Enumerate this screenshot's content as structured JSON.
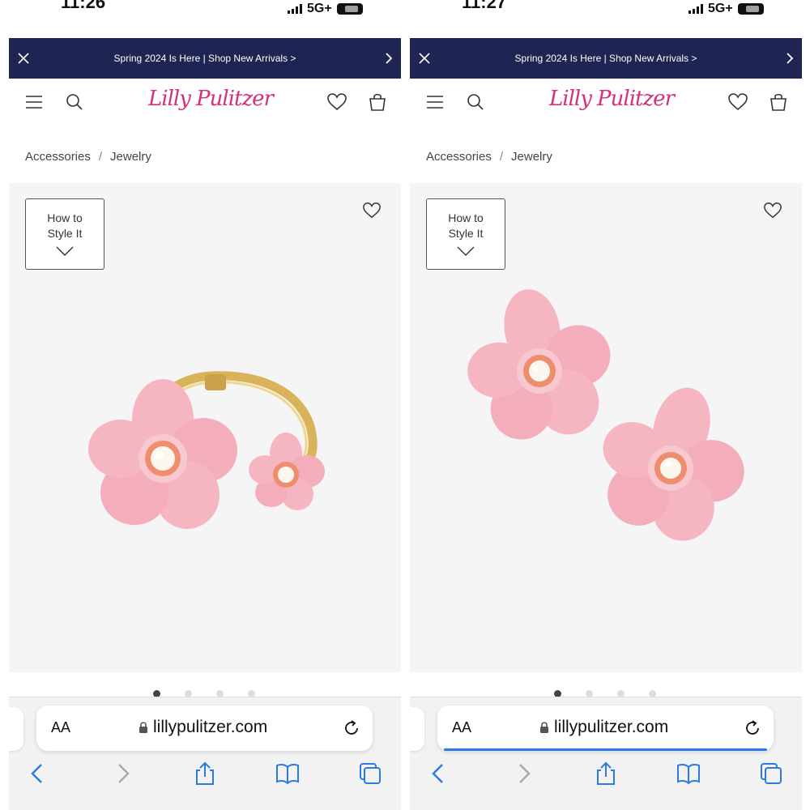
{
  "screens": [
    {
      "status": {
        "time": "11:26",
        "network": "5G+"
      },
      "banner": {
        "text": "Spring 2024 Is Here | Shop New Arrivals >"
      },
      "brand": {
        "logo": "Lilly Pulitzer"
      },
      "breadcrumb": {
        "item1": "Accessories",
        "sep": "/",
        "item2": "Jewelry"
      },
      "product": {
        "style_line1": "How to",
        "style_line2": "Style It",
        "image": "pink flower pearl cuff bracelet"
      },
      "carousel": {
        "count": 4,
        "active": 0
      },
      "browser": {
        "aa": "AA",
        "url": "lillypulitzer.com",
        "loading": false
      }
    },
    {
      "status": {
        "time": "11:27",
        "network": "5G+"
      },
      "banner": {
        "text": "Spring 2024 Is Here | Shop New Arrivals >"
      },
      "brand": {
        "logo": "Lilly Pulitzer"
      },
      "breadcrumb": {
        "item1": "Accessories",
        "sep": "/",
        "item2": "Jewelry"
      },
      "product": {
        "style_line1": "How to",
        "style_line2": "Style It",
        "image": "pink flower pearl stud earrings"
      },
      "carousel": {
        "count": 4,
        "active": 0
      },
      "browser": {
        "aa": "AA",
        "url": "lillypulitzer.com",
        "loading": true
      }
    }
  ],
  "colors": {
    "banner": "#1e2552",
    "logo": "#d6307a",
    "petal": "#f5b6c2",
    "gold": "#d9b35a",
    "ios_blue": "#2a7ae2"
  },
  "icons": [
    "close-icon",
    "chevron-right-icon",
    "menu-icon",
    "search-icon",
    "heart-icon",
    "bag-icon",
    "chevron-down-icon",
    "lock-icon",
    "reload-icon",
    "back-icon",
    "forward-icon",
    "share-icon",
    "bookmarks-icon",
    "tabs-icon"
  ]
}
